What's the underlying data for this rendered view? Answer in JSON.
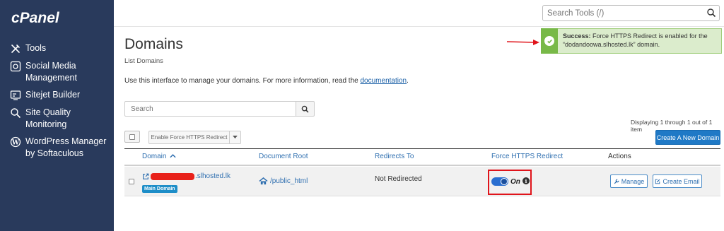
{
  "app": {
    "logo": "cPanel",
    "search_tools_placeholder": "Search Tools (/)"
  },
  "sidebar": {
    "items": [
      {
        "label": "Tools",
        "icon": "tools-icon"
      },
      {
        "label": "Social Media Management",
        "icon": "social-media-icon"
      },
      {
        "label": "Sitejet Builder",
        "icon": "sitejet-icon"
      },
      {
        "label": "Site Quality Monitoring",
        "icon": "site-quality-icon"
      },
      {
        "label": "WordPress Manager by Softaculous",
        "icon": "wordpress-icon"
      }
    ]
  },
  "page": {
    "title": "Domains",
    "subtitle": "List Domains",
    "intro_text": "Use this interface to manage your domains. For more information, read the ",
    "intro_link": "documentation",
    "intro_end": "."
  },
  "alert": {
    "label": "Success:",
    "message": " Force HTTPS Redirect is enabled for the “dodandoowa.slhosted.lk” domain.",
    "color": "#78b948"
  },
  "controls": {
    "search_placeholder": "Search",
    "displaying": "Displaying 1 through 1 out of 1 item",
    "bulk_action": "Enable Force HTTPS Redirect",
    "create_domain": "Create A New Domain"
  },
  "table": {
    "headers": {
      "domain": "Domain",
      "document_root": "Document Root",
      "redirects_to": "Redirects To",
      "force_https": "Force HTTPS Redirect",
      "actions": "Actions"
    },
    "rows": [
      {
        "domain": ".slhosted.lk",
        "badge": "Main Domain",
        "document_root": "/public_html",
        "redirects_to": "Not Redirected",
        "force_https_state": "On",
        "actions": {
          "manage": "Manage",
          "create_email": "Create Email"
        }
      }
    ]
  },
  "colors": {
    "sidebar": "#293a5c",
    "primary": "#1f79c6",
    "link": "#2f6fb0",
    "highlight": "#e0141b"
  }
}
